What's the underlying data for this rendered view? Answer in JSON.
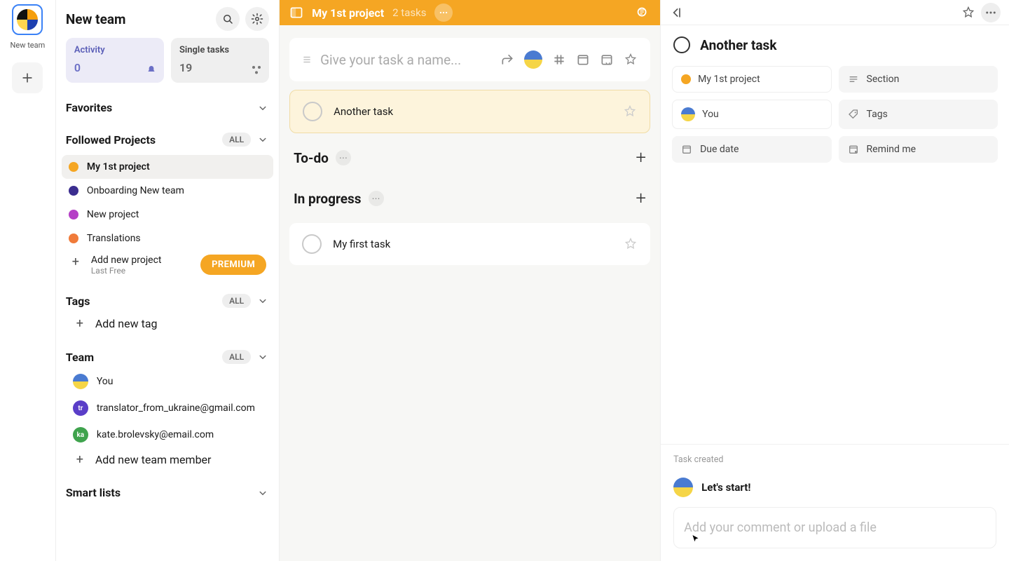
{
  "teambar": {
    "team_name": "New team"
  },
  "sidebar": {
    "title": "New team",
    "activity_card": {
      "title": "Activity",
      "count": "0"
    },
    "single_card": {
      "title": "Single tasks",
      "count": "19"
    },
    "favorites_label": "Favorites",
    "followed_label": "Followed Projects",
    "followed_badge": "ALL",
    "projects": [
      {
        "name": "My 1st project",
        "color": "#f5a623",
        "active": true
      },
      {
        "name": "Onboarding New team",
        "color": "#3b2d8f"
      },
      {
        "name": "New project",
        "color": "#b53fc6"
      },
      {
        "name": "Translations",
        "color": "#f07b3a"
      }
    ],
    "add_project_label": "Add new project",
    "add_project_sub": "Last Free",
    "premium_label": "PREMIUM",
    "tags_label": "Tags",
    "tags_badge": "ALL",
    "add_tag_label": "Add new tag",
    "team_label": "Team",
    "team_badge": "ALL",
    "members": [
      {
        "name": "You",
        "avatar_class": "flag"
      },
      {
        "name": "translator_from_ukraine@gmail.com",
        "avatar_class": "tr",
        "initials": "tr"
      },
      {
        "name": "kate.brolevsky@email.com",
        "avatar_class": "ka",
        "initials": "ka"
      }
    ],
    "add_member_label": "Add new team member",
    "smartlists_label": "Smart lists"
  },
  "main": {
    "header_title": "My 1st project",
    "header_sub": "2 tasks",
    "create_placeholder": "Give your task a name...",
    "tasks": [
      {
        "name": "Another task",
        "highlight": true
      },
      {
        "section": "To-do"
      },
      {
        "section": "In progress"
      },
      {
        "name": "My first task"
      }
    ],
    "section_todo": "To-do",
    "section_progress": "In progress"
  },
  "detail": {
    "title": "Another task",
    "project_chip": "My 1st project",
    "project_color": "#f5a623",
    "section_chip": "Section",
    "you_chip": "You",
    "tags_chip": "Tags",
    "due_chip": "Due date",
    "remind_chip": "Remind me",
    "task_created": "Task created",
    "comment_author": "Let's start!",
    "comment_placeholder": "Add your comment or upload a file"
  }
}
